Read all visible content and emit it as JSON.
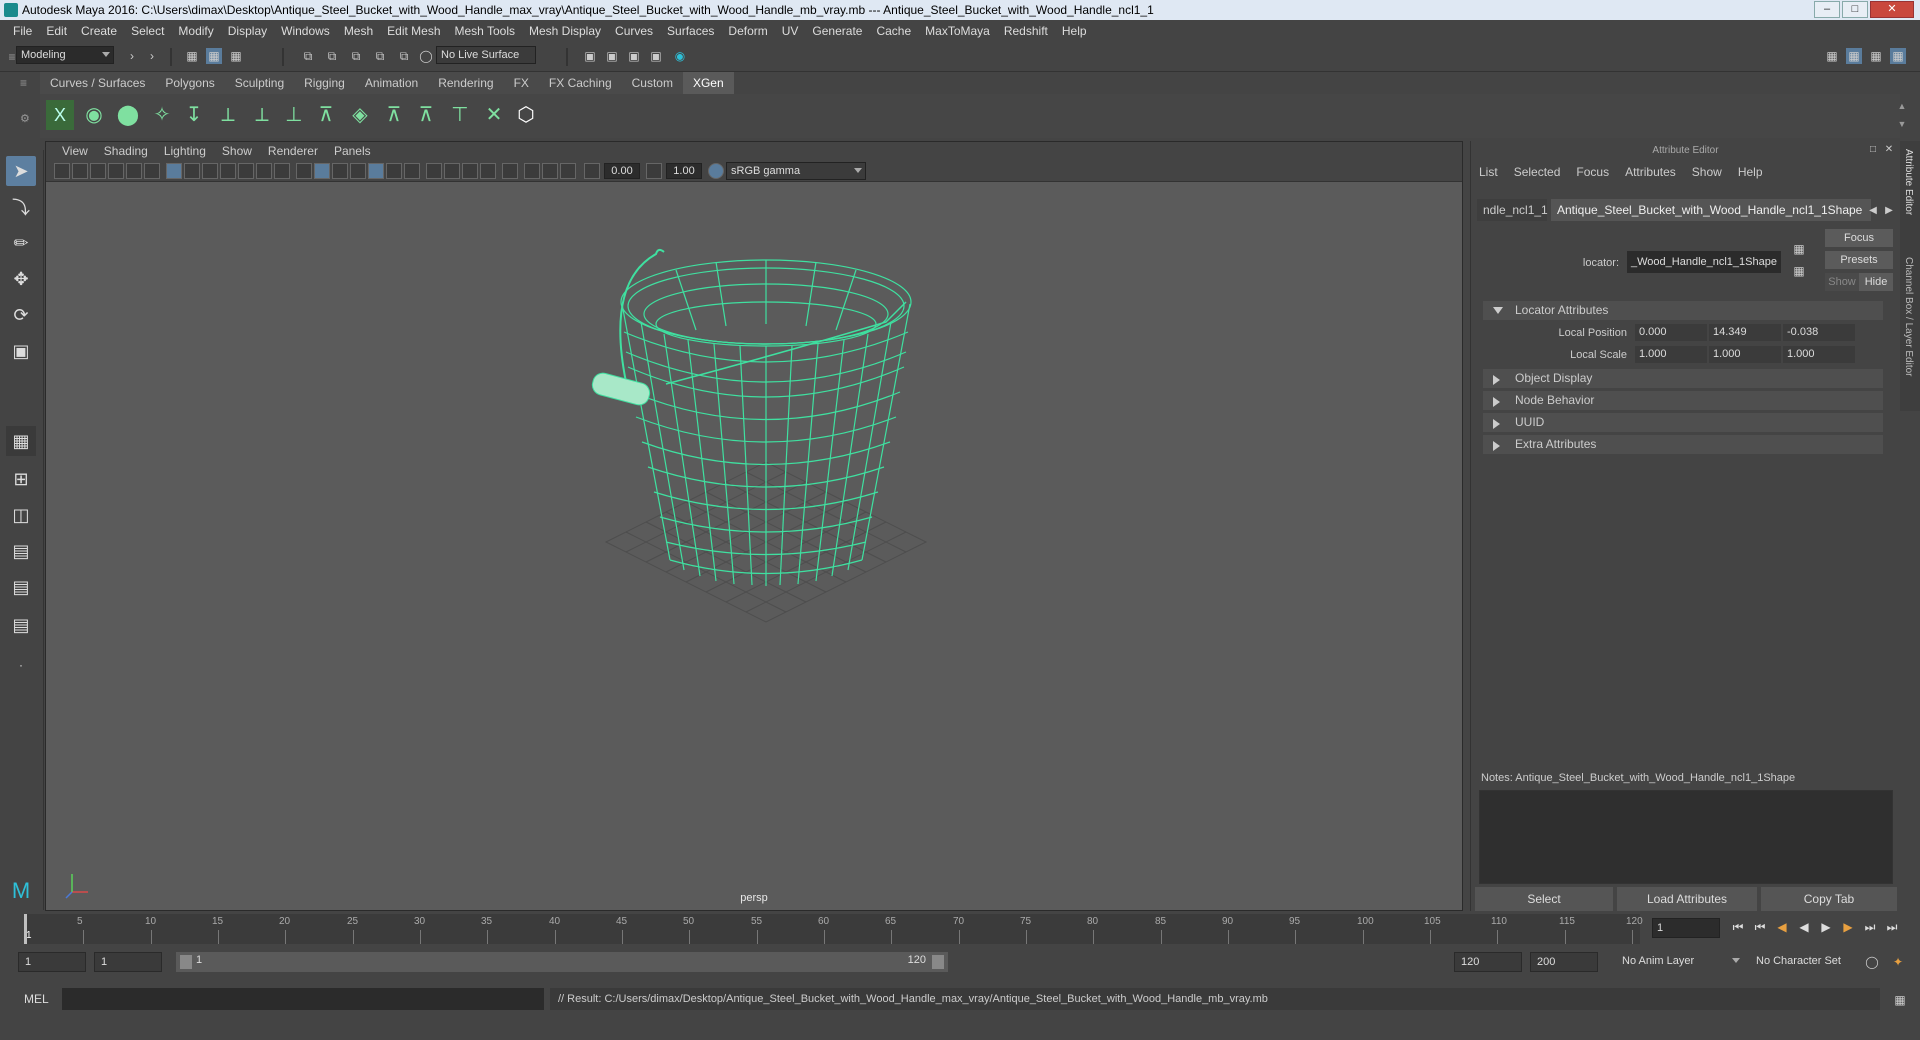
{
  "title": "Autodesk Maya 2016: C:\\Users\\dimax\\Desktop\\Antique_Steel_Bucket_with_Wood_Handle_max_vray\\Antique_Steel_Bucket_with_Wood_Handle_mb_vray.mb  ---  Antique_Steel_Bucket_with_Wood_Handle_ncl1_1",
  "menu": [
    "File",
    "Edit",
    "Create",
    "Select",
    "Modify",
    "Display",
    "Windows",
    "Mesh",
    "Edit Mesh",
    "Mesh Tools",
    "Mesh Display",
    "Curves",
    "Surfaces",
    "Deform",
    "UV",
    "Generate",
    "Cache",
    "MaxToMaya",
    "Redshift",
    "Help"
  ],
  "status": {
    "mode": "Modeling",
    "live_surface": "No Live Surface"
  },
  "shelf_tabs": [
    "Curves / Surfaces",
    "Polygons",
    "Sculpting",
    "Rigging",
    "Animation",
    "Rendering",
    "FX",
    "FX Caching",
    "Custom",
    "XGen"
  ],
  "shelf_active": "XGen",
  "viewport": {
    "menu": [
      "View",
      "Shading",
      "Lighting",
      "Show",
      "Renderer",
      "Panels"
    ],
    "exposure": "0.00",
    "gamma": "1.00",
    "color_space": "sRGB gamma",
    "camera": "persp",
    "wire_color": "#3fe0a0"
  },
  "attr_editor": {
    "header": "Attribute Editor",
    "menu": [
      "List",
      "Selected",
      "Focus",
      "Attributes",
      "Show",
      "Help"
    ],
    "tab1": "ndle_ncl1_1",
    "tab2": "Antique_Steel_Bucket_with_Wood_Handle_ncl1_1Shape",
    "locator_label": "locator:",
    "locator_value": "_Wood_Handle_ncl1_1Shape",
    "focus": "Focus",
    "presets": "Presets",
    "show": "Show",
    "hide": "Hide",
    "section_locator": "Locator Attributes",
    "local_position_label": "Local Position",
    "local_position": [
      "0.000",
      "14.349",
      "-0.038"
    ],
    "local_scale_label": "Local Scale",
    "local_scale": [
      "1.000",
      "1.000",
      "1.000"
    ],
    "sections": [
      "Object Display",
      "Node Behavior",
      "UUID",
      "Extra Attributes"
    ],
    "notes_label": "Notes:",
    "notes_value": "Antique_Steel_Bucket_with_Wood_Handle_ncl1_1Shape",
    "buttons": [
      "Select",
      "Load Attributes",
      "Copy Tab"
    ]
  },
  "side_tabs": [
    "Attribute Editor",
    "Channel Box / Layer Editor"
  ],
  "timeline": {
    "ticks": [
      "5",
      "10",
      "15",
      "20",
      "25",
      "30",
      "35",
      "40",
      "45",
      "50",
      "55",
      "60",
      "65",
      "70",
      "75",
      "80",
      "85",
      "90",
      "95",
      "100",
      "105",
      "110",
      "115",
      "120"
    ],
    "start_label": "1",
    "current_frame": "1"
  },
  "range": {
    "start": "1",
    "start2": "1",
    "slider_start": "1",
    "slider_end": "120",
    "end": "120",
    "end2": "200",
    "anim_layer": "No Anim Layer",
    "char_set": "No Character Set"
  },
  "cmd": {
    "lang": "MEL",
    "result": "// Result: C:/Users/dimax/Desktop/Antique_Steel_Bucket_with_Wood_Handle_max_vray/Antique_Steel_Bucket_with_Wood_Handle_mb_vray.mb"
  }
}
